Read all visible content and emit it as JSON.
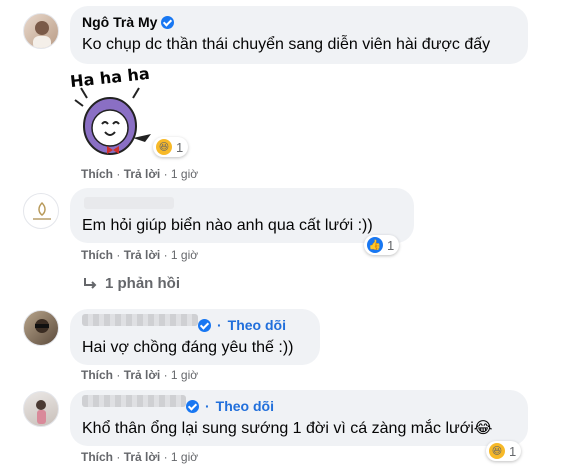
{
  "comments": [
    {
      "name": "Ngô Trà My",
      "text": "Ko chụp dc thần thái chuyển sang diễn viên hài được đấy",
      "sticker_text": "Ha ha ha",
      "reaction_count": "1",
      "like_label": "Thích",
      "reply_label": "Trả lời",
      "time": "1 giờ"
    },
    {
      "name": "",
      "text": "Em hỏi giúp biển nào anh qua cất lưới :))",
      "reaction_count": "1",
      "like_label": "Thích",
      "reply_label": "Trả lời",
      "time": "1 giờ",
      "replies_label": "1 phản hồi"
    },
    {
      "name": "",
      "follow_label": "Theo dõi",
      "text": "Hai vợ chồng đáng yêu thế :))",
      "like_label": "Thích",
      "reply_label": "Trả lời",
      "time": "1 giờ"
    },
    {
      "name": "",
      "follow_label": "Theo dõi",
      "text": "Khổ thân ổng lại sung sướng 1 đời vì cá zàng mắc lưới",
      "emoji": "😂",
      "reaction_count": "1",
      "like_label": "Thích",
      "reply_label": "Trả lời",
      "time": "1 giờ"
    }
  ],
  "separator": "·",
  "colors": {
    "bubble": "#f0f2f5",
    "link": "#216fdb",
    "meta": "#65676b",
    "verified": "#1877f2"
  }
}
